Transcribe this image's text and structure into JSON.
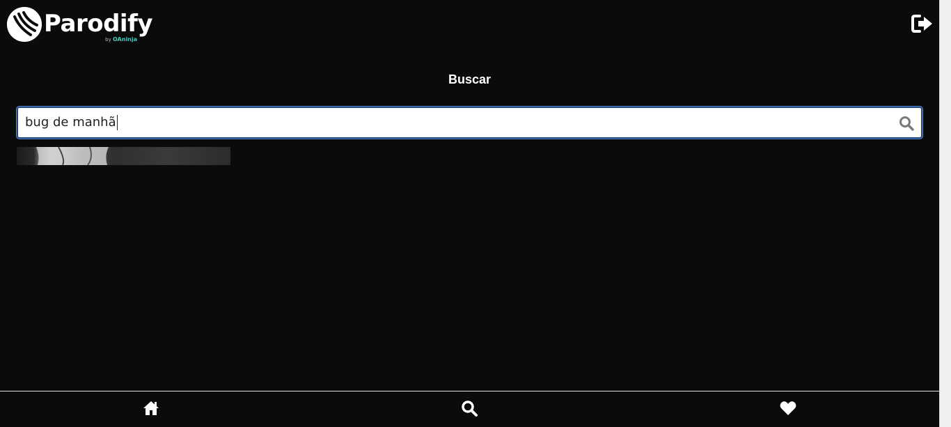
{
  "header": {
    "brand_name": "Parodify",
    "brand_by": "by",
    "brand_partner": "OAninja",
    "logout_icon": "sign-out-icon"
  },
  "page": {
    "heading": "Buscar"
  },
  "search": {
    "value": "bug de manhã",
    "icon": "search-icon"
  },
  "results": [
    {
      "type": "thumbnail"
    }
  ],
  "nav": {
    "items": [
      {
        "icon": "home-icon"
      },
      {
        "icon": "search-icon"
      },
      {
        "icon": "heart-icon"
      }
    ]
  },
  "colors": {
    "background": "#0b0b0b",
    "text": "#ffffff",
    "accent_focus": "#1f4a8a",
    "partner_brand": "#3fc9c2"
  }
}
